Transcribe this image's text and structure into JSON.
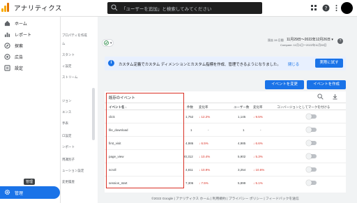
{
  "app": {
    "title": "アナリティクス"
  },
  "search": {
    "placeholder": "「ユーザーを追加」と検索してみてください"
  },
  "nav": {
    "items": [
      {
        "label": "ホーム",
        "icon": "home-icon"
      },
      {
        "label": "レポート",
        "icon": "reports-icon"
      },
      {
        "label": "探索",
        "icon": "explore-icon"
      },
      {
        "label": "広告",
        "icon": "advertising-icon"
      },
      {
        "label": "設定",
        "icon": "configure-icon"
      }
    ],
    "tooltip": "管理",
    "admin_label": "管理"
  },
  "subnav": {
    "items": [
      "プロパティを作成",
      "ム",
      "スタント",
      "ィ設定",
      "ストリーム",
      "ジョン",
      "エンス",
      "手表",
      "ロ設定",
      "ンポート",
      "用識別子",
      "ューション設定",
      "変更履歴"
    ]
  },
  "header": {
    "date_label": "過去 28 日間",
    "date_range": "11月29日〜2022年12月26日 ▾",
    "compare": "Compare: 11月1日〜2022年11月28日"
  },
  "banner": {
    "text": "カスタム定義でカスタム ディメンションとカスタム指標を作成、管理できるようになりました。",
    "close": "閉じる",
    "action": "実際に試す"
  },
  "actions": {
    "modify": "イベントを変更",
    "create": "イベントを作成"
  },
  "table": {
    "title": "既存のイベント",
    "headers": {
      "name": "イベント名 ↓",
      "count": "件数",
      "change": "変化率",
      "users": "ユーザー数",
      "uchange": "変化率",
      "conversion": "コンバージョンとしてマークを付ける"
    },
    "rows": [
      {
        "name": "click",
        "count": "1,752",
        "change": "↓ 12.2%",
        "users": "1,145",
        "uchange": "↓ 9.5%"
      },
      {
        "name": "file_download",
        "count": "1",
        "change": "-",
        "users": "1",
        "uchange": "-"
      },
      {
        "name": "first_visit",
        "count": "4,986",
        "change": "↓ 6.5%",
        "users": "4,985",
        "uchange": "↓ 6.6%"
      },
      {
        "name": "page_view",
        "count": "20,312",
        "change": "↓ 10.4%",
        "users": "5,902",
        "uchange": "↓ 5.3%"
      },
      {
        "name": "scroll",
        "count": "4,811",
        "change": "↓ 10.9%",
        "users": "3,254",
        "uchange": "↓ 10.6%"
      },
      {
        "name": "session_start",
        "count": "7,306",
        "change": "↓ 7.5%",
        "users": "5,899",
        "uchange": "↓ 5.1%"
      }
    ]
  },
  "footer": {
    "text": "©2022 Google | アナリティクス ホーム | 利用規約 | プライバシー ポリシー | フィードバックを送信"
  },
  "colors": {
    "accent": "#1a73e8",
    "negative": "#d93025",
    "highlight": "#d93025"
  }
}
